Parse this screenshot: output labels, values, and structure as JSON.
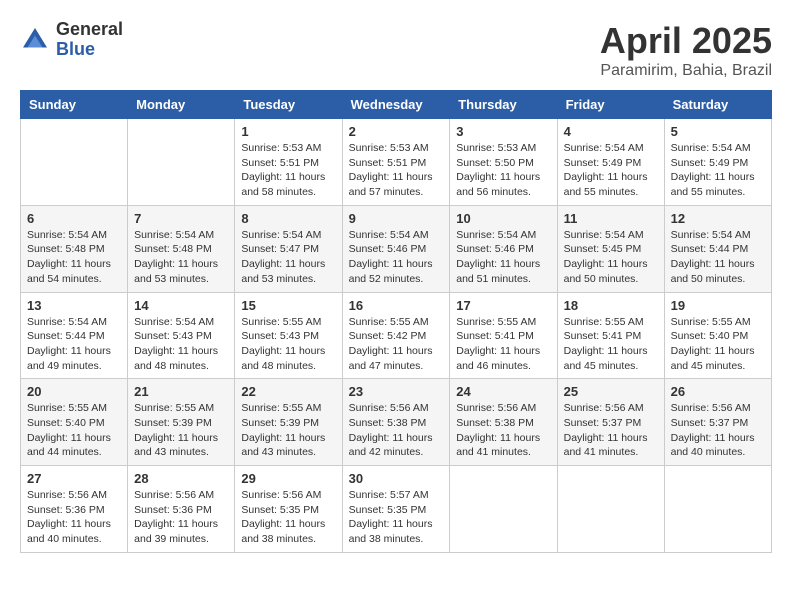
{
  "logo": {
    "general": "General",
    "blue": "Blue"
  },
  "title": "April 2025",
  "location": "Paramirim, Bahia, Brazil",
  "days_of_week": [
    "Sunday",
    "Monday",
    "Tuesday",
    "Wednesday",
    "Thursday",
    "Friday",
    "Saturday"
  ],
  "weeks": [
    [
      {
        "day": "",
        "info": ""
      },
      {
        "day": "",
        "info": ""
      },
      {
        "day": "1",
        "info": "Sunrise: 5:53 AM\nSunset: 5:51 PM\nDaylight: 11 hours and 58 minutes."
      },
      {
        "day": "2",
        "info": "Sunrise: 5:53 AM\nSunset: 5:51 PM\nDaylight: 11 hours and 57 minutes."
      },
      {
        "day": "3",
        "info": "Sunrise: 5:53 AM\nSunset: 5:50 PM\nDaylight: 11 hours and 56 minutes."
      },
      {
        "day": "4",
        "info": "Sunrise: 5:54 AM\nSunset: 5:49 PM\nDaylight: 11 hours and 55 minutes."
      },
      {
        "day": "5",
        "info": "Sunrise: 5:54 AM\nSunset: 5:49 PM\nDaylight: 11 hours and 55 minutes."
      }
    ],
    [
      {
        "day": "6",
        "info": "Sunrise: 5:54 AM\nSunset: 5:48 PM\nDaylight: 11 hours and 54 minutes."
      },
      {
        "day": "7",
        "info": "Sunrise: 5:54 AM\nSunset: 5:48 PM\nDaylight: 11 hours and 53 minutes."
      },
      {
        "day": "8",
        "info": "Sunrise: 5:54 AM\nSunset: 5:47 PM\nDaylight: 11 hours and 53 minutes."
      },
      {
        "day": "9",
        "info": "Sunrise: 5:54 AM\nSunset: 5:46 PM\nDaylight: 11 hours and 52 minutes."
      },
      {
        "day": "10",
        "info": "Sunrise: 5:54 AM\nSunset: 5:46 PM\nDaylight: 11 hours and 51 minutes."
      },
      {
        "day": "11",
        "info": "Sunrise: 5:54 AM\nSunset: 5:45 PM\nDaylight: 11 hours and 50 minutes."
      },
      {
        "day": "12",
        "info": "Sunrise: 5:54 AM\nSunset: 5:44 PM\nDaylight: 11 hours and 50 minutes."
      }
    ],
    [
      {
        "day": "13",
        "info": "Sunrise: 5:54 AM\nSunset: 5:44 PM\nDaylight: 11 hours and 49 minutes."
      },
      {
        "day": "14",
        "info": "Sunrise: 5:54 AM\nSunset: 5:43 PM\nDaylight: 11 hours and 48 minutes."
      },
      {
        "day": "15",
        "info": "Sunrise: 5:55 AM\nSunset: 5:43 PM\nDaylight: 11 hours and 48 minutes."
      },
      {
        "day": "16",
        "info": "Sunrise: 5:55 AM\nSunset: 5:42 PM\nDaylight: 11 hours and 47 minutes."
      },
      {
        "day": "17",
        "info": "Sunrise: 5:55 AM\nSunset: 5:41 PM\nDaylight: 11 hours and 46 minutes."
      },
      {
        "day": "18",
        "info": "Sunrise: 5:55 AM\nSunset: 5:41 PM\nDaylight: 11 hours and 45 minutes."
      },
      {
        "day": "19",
        "info": "Sunrise: 5:55 AM\nSunset: 5:40 PM\nDaylight: 11 hours and 45 minutes."
      }
    ],
    [
      {
        "day": "20",
        "info": "Sunrise: 5:55 AM\nSunset: 5:40 PM\nDaylight: 11 hours and 44 minutes."
      },
      {
        "day": "21",
        "info": "Sunrise: 5:55 AM\nSunset: 5:39 PM\nDaylight: 11 hours and 43 minutes."
      },
      {
        "day": "22",
        "info": "Sunrise: 5:55 AM\nSunset: 5:39 PM\nDaylight: 11 hours and 43 minutes."
      },
      {
        "day": "23",
        "info": "Sunrise: 5:56 AM\nSunset: 5:38 PM\nDaylight: 11 hours and 42 minutes."
      },
      {
        "day": "24",
        "info": "Sunrise: 5:56 AM\nSunset: 5:38 PM\nDaylight: 11 hours and 41 minutes."
      },
      {
        "day": "25",
        "info": "Sunrise: 5:56 AM\nSunset: 5:37 PM\nDaylight: 11 hours and 41 minutes."
      },
      {
        "day": "26",
        "info": "Sunrise: 5:56 AM\nSunset: 5:37 PM\nDaylight: 11 hours and 40 minutes."
      }
    ],
    [
      {
        "day": "27",
        "info": "Sunrise: 5:56 AM\nSunset: 5:36 PM\nDaylight: 11 hours and 40 minutes."
      },
      {
        "day": "28",
        "info": "Sunrise: 5:56 AM\nSunset: 5:36 PM\nDaylight: 11 hours and 39 minutes."
      },
      {
        "day": "29",
        "info": "Sunrise: 5:56 AM\nSunset: 5:35 PM\nDaylight: 11 hours and 38 minutes."
      },
      {
        "day": "30",
        "info": "Sunrise: 5:57 AM\nSunset: 5:35 PM\nDaylight: 11 hours and 38 minutes."
      },
      {
        "day": "",
        "info": ""
      },
      {
        "day": "",
        "info": ""
      },
      {
        "day": "",
        "info": ""
      }
    ]
  ]
}
